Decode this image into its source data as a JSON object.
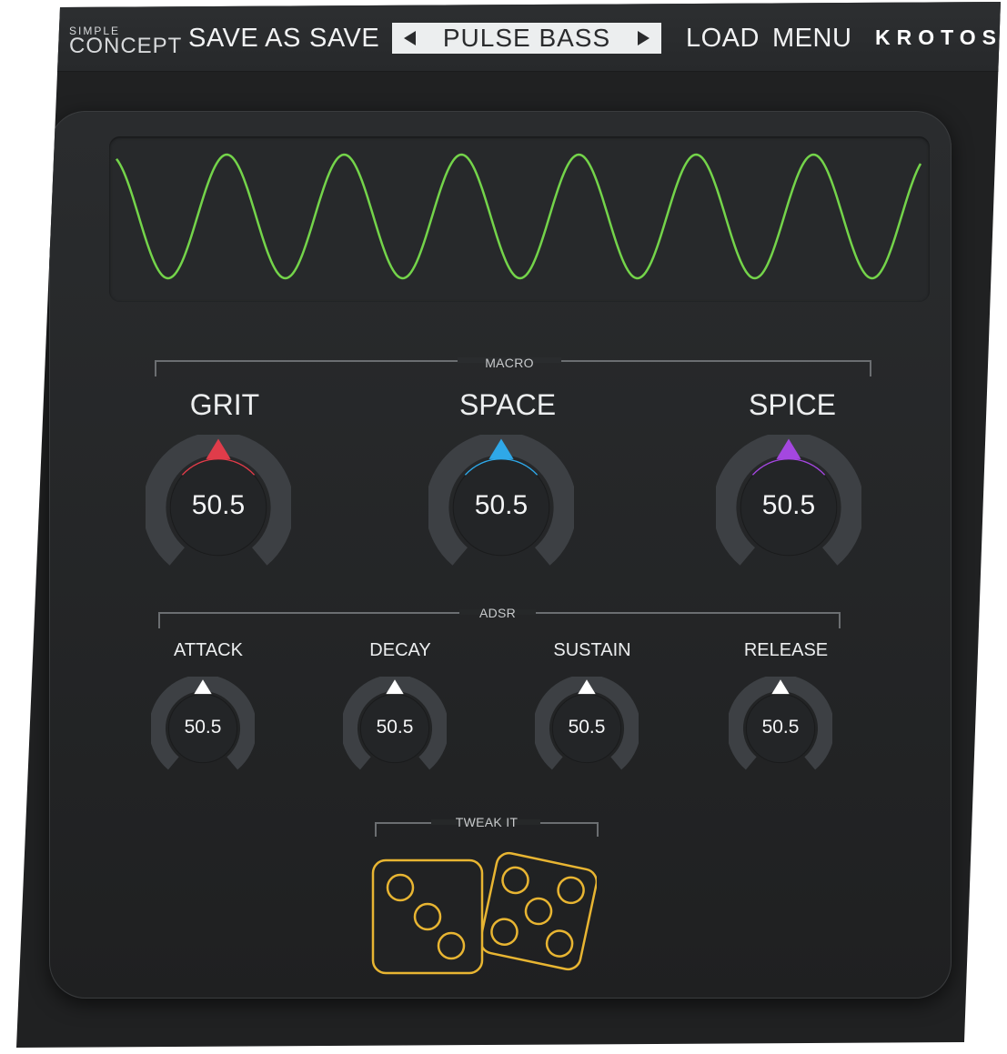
{
  "header": {
    "logo_small": "SIMPLE",
    "logo_big": "CONCEPT",
    "save_as": "SAVE AS",
    "save": "SAVE",
    "preset_name": "PULSE BASS",
    "load": "LOAD",
    "menu": "MENU",
    "brand": "KROTOS"
  },
  "oscilloscope": {
    "wave_color": "#74d44a"
  },
  "macro": {
    "label": "MACRO",
    "knobs": [
      {
        "title": "GRIT",
        "value": "50.5",
        "accent": "#e03c4a"
      },
      {
        "title": "SPACE",
        "value": "50.5",
        "accent": "#2fa8e8"
      },
      {
        "title": "SPICE",
        "value": "50.5",
        "accent": "#a447e0"
      }
    ]
  },
  "adsr": {
    "label": "ADSR",
    "knobs": [
      {
        "title": "ATTACK",
        "value": "50.5"
      },
      {
        "title": "DECAY",
        "value": "50.5"
      },
      {
        "title": "SUSTAIN",
        "value": "50.5"
      },
      {
        "title": "RELEASE",
        "value": "50.5"
      }
    ]
  },
  "tweak": {
    "label": "TWEAK IT",
    "dice_icon": "dice-icon",
    "dice_color": "#e8b532"
  }
}
